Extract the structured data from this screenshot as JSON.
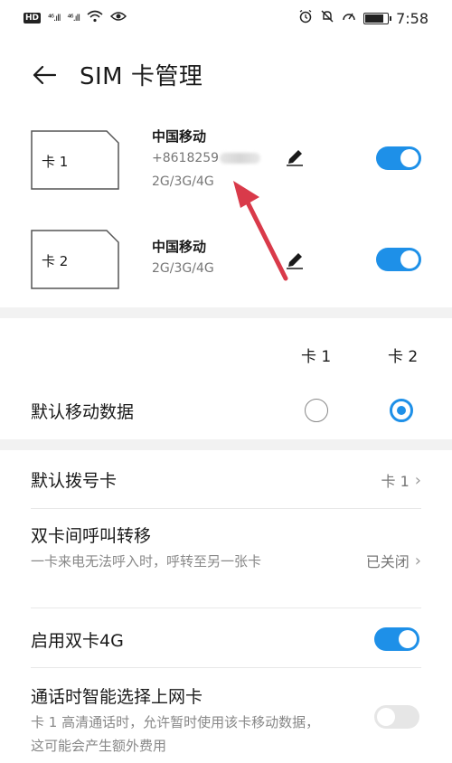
{
  "status_bar": {
    "hd": "HD",
    "sig1": "⁴⁶.ıll",
    "sig2": "⁴⁶.ıll",
    "time": "7:58",
    "battery_level": 0.85,
    "icons": [
      "wifi-icon",
      "eye-icon",
      "alarm-icon",
      "mute-icon",
      "speedometer-icon",
      "battery-icon"
    ]
  },
  "header": {
    "title": "SIM 卡管理"
  },
  "sims": [
    {
      "card_label": "卡 1",
      "carrier": "中国移动",
      "number": "+8618259",
      "network": "2G/3G/4G",
      "enabled": true
    },
    {
      "card_label": "卡 2",
      "carrier": "中国移动",
      "network": "2G/3G/4G",
      "enabled": true
    }
  ],
  "columns": {
    "card1": "卡 1",
    "card2": "卡 2"
  },
  "default_data": {
    "label": "默认移动数据",
    "selected": "card2"
  },
  "default_dial": {
    "label": "默认拨号卡",
    "value": "卡 1"
  },
  "call_forward": {
    "label": "双卡间呼叫转移",
    "sub": "一卡来电无法呼入时，呼转至另一张卡",
    "value": "已关闭"
  },
  "dual_4g": {
    "label": "启用双卡4G",
    "enabled": true
  },
  "smart_data": {
    "label": "通话时智能选择上网卡",
    "sub": "卡 1 高清通话时，允许暂时使用该卡移动数据，这可能会产生额外费用",
    "enabled": false
  },
  "colors": {
    "accent": "#1e90e8",
    "arrow": "#d93a4a"
  }
}
